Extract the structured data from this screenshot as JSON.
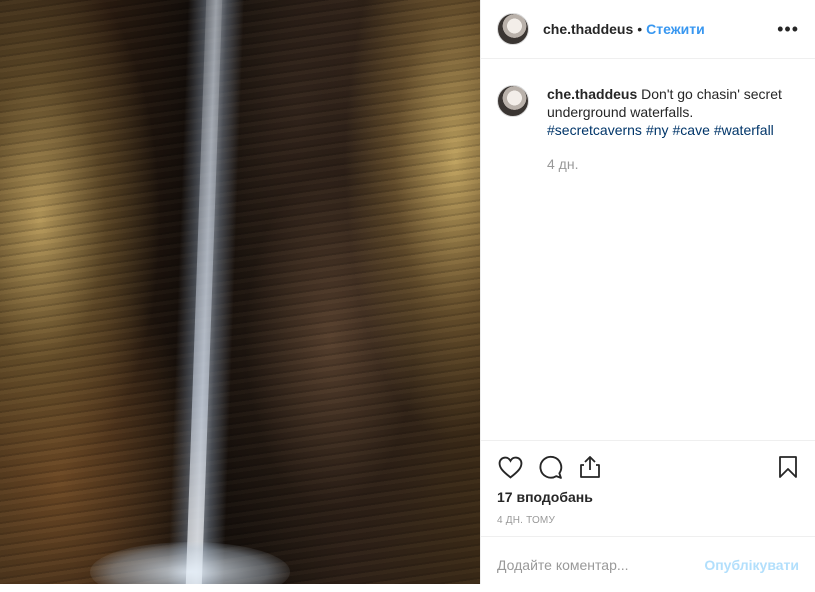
{
  "post": {
    "username": "che.thaddeus",
    "follow_separator": "•",
    "follow_label": "Стежити",
    "more_label": "•••",
    "image_alt": "Underground waterfall in a cave"
  },
  "caption": {
    "username": "che.thaddeus",
    "text": "Don't go chasin' secret underground waterfalls.",
    "hashtags": [
      "#secretcaverns",
      "#ny",
      "#cave",
      "#waterfall"
    ],
    "time": "4 дн."
  },
  "actions": {
    "like_icon": "heart-icon",
    "comment_icon": "comment-icon",
    "share_icon": "share-icon",
    "save_icon": "bookmark-icon"
  },
  "likes": "17 вподобань",
  "posted_ago": "4 ДН. ТОМУ",
  "comment_box": {
    "placeholder": "Додайте коментар...",
    "publish_label": "Опублікувати"
  },
  "colors": {
    "link_blue": "#3897f0",
    "hashtag": "#003569",
    "muted": "#999999",
    "publish_disabled": "#b2dffc",
    "border": "#efefef"
  }
}
